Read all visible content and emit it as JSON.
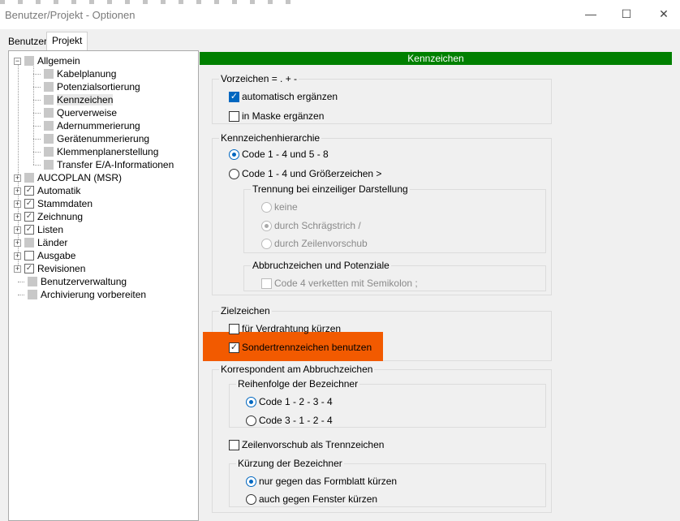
{
  "window": {
    "title": "Benutzer/Projekt - Optionen",
    "minimize": "—",
    "maximize": "☐",
    "close": "✕"
  },
  "tabs": [
    {
      "label": "Benutzer",
      "active": false
    },
    {
      "label": "Projekt",
      "active": true
    }
  ],
  "tree": {
    "allgemein": "Allgemein",
    "children": [
      "Kabelplanung",
      "Potenzialsortierung",
      "Kennzeichen",
      "Querverweise",
      "Adernummerierung",
      "Gerätenummerierung",
      "Klemmenplanerstellung",
      "Transfer E/A-Informationen"
    ],
    "top": [
      {
        "label": "AUCOPLAN (MSR)",
        "state": "gray",
        "expand": true
      },
      {
        "label": "Automatik",
        "state": "checked",
        "expand": true
      },
      {
        "label": "Stammdaten",
        "state": "checked",
        "expand": true
      },
      {
        "label": "Zeichnung",
        "state": "checked",
        "expand": true
      },
      {
        "label": "Listen",
        "state": "checked",
        "expand": true
      },
      {
        "label": "Länder",
        "state": "gray",
        "expand": true
      },
      {
        "label": "Ausgabe",
        "state": "unchecked",
        "expand": true
      },
      {
        "label": "Revisionen",
        "state": "checked",
        "expand": true
      },
      {
        "label": "Benutzerverwaltung",
        "state": "gray",
        "expand": false
      },
      {
        "label": "Archivierung vorbereiten",
        "state": "gray",
        "expand": false
      }
    ]
  },
  "panel": {
    "header": "Kennzeichen",
    "header_color": "#008000",
    "vorzeichen": {
      "label": "Vorzeichen = . + -",
      "auto": "automatisch ergänzen",
      "maske": "in Maske ergänzen"
    },
    "hierarchie": {
      "label": "Kennzeichenhierarchie",
      "opt1": "Code 1 - 4 und 5 - 8",
      "opt2": "Code 1 - 4 und Größerzeichen  >",
      "trennung": {
        "label": "Trennung bei einzeiliger Darstellung",
        "o1": "keine",
        "o2": "durch Schrägstrich /",
        "o3": "durch Zeilenvorschub"
      },
      "abbruch": {
        "label": "Abbruchzeichen und Potenziale",
        "c1": "Code 4 verketten mit Semikolon ;"
      }
    },
    "ziel": {
      "label": "Zielzeichen",
      "c1": "für Verdrahtung kürzen",
      "c2": "Sondertrennzeichen benutzen",
      "highlight_color": "#f25a00"
    },
    "korr": {
      "label": "Korrespondent am Abbruchzeichen",
      "reihe": {
        "label": "Reihenfolge der Bezeichner",
        "o1": "Code 1 - 2 - 3 - 4",
        "o2": "Code 3 - 1 - 2 - 4"
      },
      "zeilen": "Zeilenvorschub als Trennzeichen",
      "kurz": {
        "label": "Kürzung der Bezeichner",
        "o1": "nur gegen das Formblatt kürzen",
        "o2": "auch gegen Fenster kürzen"
      }
    }
  }
}
